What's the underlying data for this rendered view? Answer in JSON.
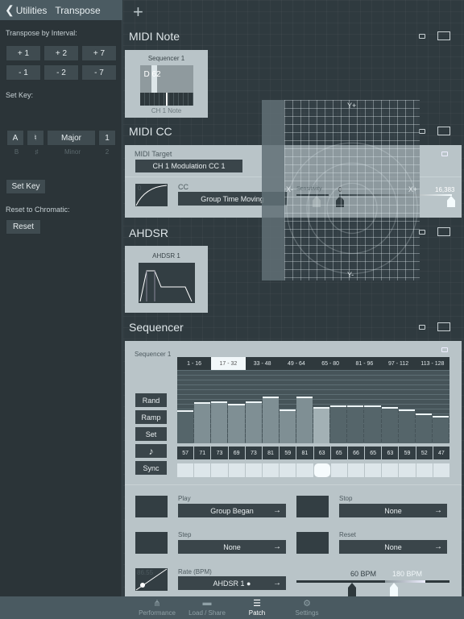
{
  "left_panel": {
    "back_label": "Utilities",
    "title": "Transpose",
    "interval_label": "Transpose by Interval:",
    "interval_buttons": [
      "+ 1",
      "+ 2",
      "+ 7",
      "- 1",
      "- 2",
      "- 7"
    ],
    "set_key_label": "Set Key:",
    "picker": {
      "note": [
        "A",
        "B"
      ],
      "accidental": [
        "♮",
        "♯"
      ],
      "scale": [
        "Major",
        "Minor"
      ],
      "octave": [
        "1",
        "2"
      ]
    },
    "set_key_button": "Set Key",
    "reset_label": "Reset to Chromatic:",
    "reset_button": "Reset"
  },
  "main": {
    "add_icon": "plus-icon",
    "midi_note": {
      "title": "MIDI Note",
      "card": {
        "title": "Sequencer 1",
        "note": "D 62",
        "subtitle": "CH 1 Note"
      }
    },
    "midi_cc": {
      "title": "MIDI CC",
      "target_label": "MIDI Target",
      "target_value": "CH 1 Modulation CC 1",
      "curve_value": "0",
      "cc_label": "CC",
      "cc_value": "Group Time Moving",
      "sensitivity_label": "Sensitivity",
      "range_min": "0",
      "range_max": "16,383"
    },
    "xy_pad": {
      "y_plus": "Y+",
      "y_minus": "Y-",
      "x_minus": "X-",
      "x_plus": "X+"
    },
    "ahdsr": {
      "title": "AHDSR",
      "card_title": "AHDSR 1"
    },
    "sequencer": {
      "title": "Sequencer",
      "name": "Sequencer 1",
      "pages": [
        "1 - 16",
        "17 - 32",
        "33 - 48",
        "49 - 64",
        "65 - 80",
        "81 - 96",
        "97 - 112",
        "113 - 128"
      ],
      "selected_page": 1,
      "side_buttons": [
        "Rand",
        "Ramp",
        "Set",
        "♪",
        "Sync"
      ],
      "steps": [
        57,
        71,
        73,
        69,
        73,
        81,
        59,
        81,
        63,
        65,
        66,
        65,
        63,
        59,
        52,
        47
      ],
      "current_step": 8,
      "value_range": [
        0,
        127
      ],
      "play": {
        "label": "Play",
        "value": "Group Began"
      },
      "stop": {
        "label": "Stop",
        "value": "None"
      },
      "step": {
        "label": "Step",
        "value": "None"
      },
      "reset": {
        "label": "Reset",
        "value": "None"
      },
      "rate": {
        "label": "Rate (BPM)",
        "value": "AHDSR 1 ●",
        "curve_value": "86.55",
        "min_label": "60 BPM",
        "max_label": "180 BPM"
      },
      "arrow": "→"
    }
  },
  "tabs": [
    {
      "label": "Performance",
      "icon": "nodes-icon"
    },
    {
      "label": "Load / Share",
      "icon": "folder-icon"
    },
    {
      "label": "Patch",
      "icon": "patch-icon",
      "active": true
    },
    {
      "label": "Settings",
      "icon": "gear-icon"
    }
  ]
}
